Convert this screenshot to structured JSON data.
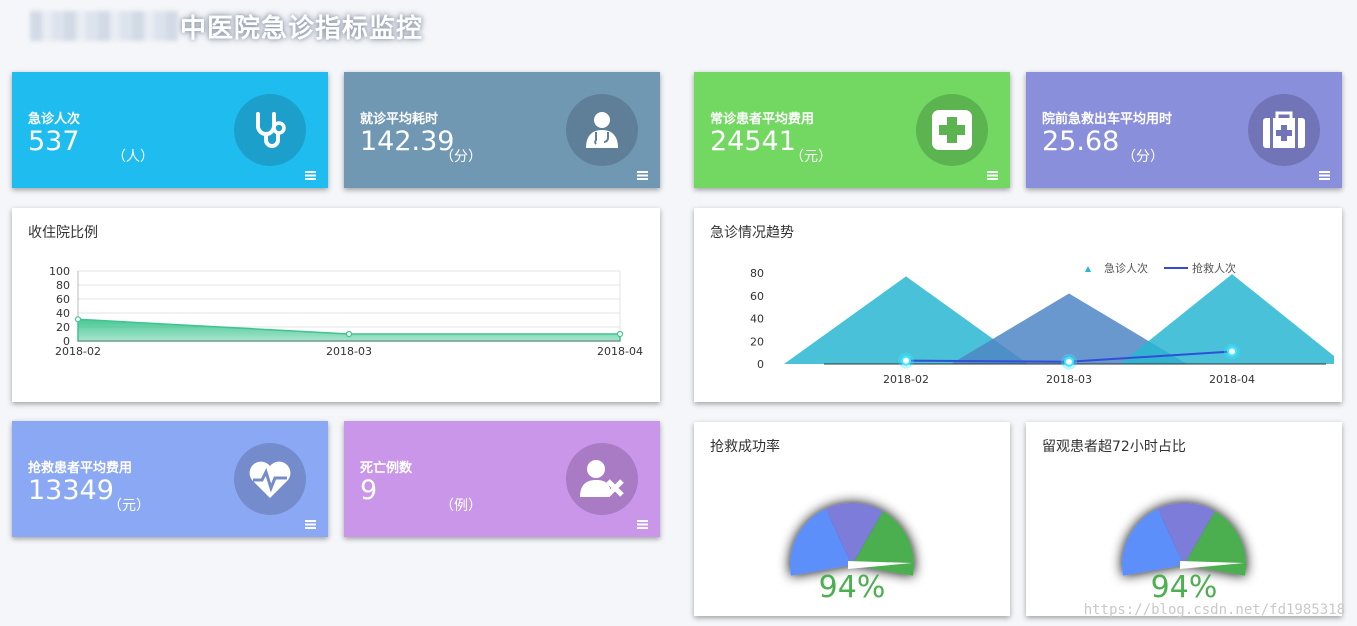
{
  "header": {
    "title_visible": "中医院急诊指标监控"
  },
  "cards": [
    {
      "label": "急诊人次",
      "value": "537",
      "unit": "（人）",
      "color": "#1fbcef",
      "icon_bg": "#1c9fcb",
      "icon": "stethoscope-icon"
    },
    {
      "label": "就诊平均耗时",
      "value": "142.39",
      "unit": "（分）",
      "color": "#7198b3",
      "icon_bg": "#5e7f97",
      "icon": "doctor-icon"
    },
    {
      "label": "常诊患者平均费用",
      "value": "24541",
      "unit": "（元）",
      "color": "#72d862",
      "icon_bg": "#5cb450",
      "icon": "medical-cross-icon"
    },
    {
      "label": "院前急救出车平均用时",
      "value": "25.68",
      "unit": "（分）",
      "color": "#8a8fdc",
      "icon_bg": "#7175b8",
      "icon": "first-aid-kit-icon"
    },
    {
      "label": "抢救患者平均费用",
      "value": "13349",
      "unit": "（元）",
      "color": "#8ba8f5",
      "icon_bg": "#748ccc",
      "icon": "heartbeat-icon"
    },
    {
      "label": "死亡例数",
      "value": "9",
      "unit": "（例）",
      "color": "#c996ea",
      "icon_bg": "#a87bc4",
      "icon": "user-remove-icon"
    }
  ],
  "panels": {
    "admission": {
      "title": "收住院比例"
    },
    "trend": {
      "title": "急诊情况趋势"
    },
    "rescue": {
      "title": "抢救成功率",
      "value": "94%"
    },
    "observe": {
      "title": "留观患者超72小时占比",
      "value": "94%"
    }
  },
  "chart_data": [
    {
      "type": "area",
      "title": "收住院比例",
      "categories": [
        "2018-02",
        "2018-03",
        "2018-04"
      ],
      "series": [
        {
          "values": [
            31,
            10,
            10
          ]
        }
      ],
      "ylim": [
        0,
        100
      ],
      "yticks": [
        0,
        20,
        40,
        60,
        80,
        100
      ],
      "grid": true,
      "color": "#3ec48f"
    },
    {
      "type": "bar",
      "title": "急诊情况趋势",
      "categories": [
        "2018-02",
        "2018-03",
        "2018-04"
      ],
      "ylim": [
        0,
        80
      ],
      "yticks": [
        0,
        20,
        40,
        60,
        80
      ],
      "series": [
        {
          "name": "急诊人次",
          "values": [
            77,
            62,
            79
          ],
          "color": "#29b6d1"
        },
        {
          "name": "抢救人次",
          "values": [
            3,
            2,
            11
          ],
          "color": "#2f4fd8"
        }
      ],
      "legend": "top-center"
    }
  ],
  "watermark": "https://blog.csdn.net/fd1985318"
}
